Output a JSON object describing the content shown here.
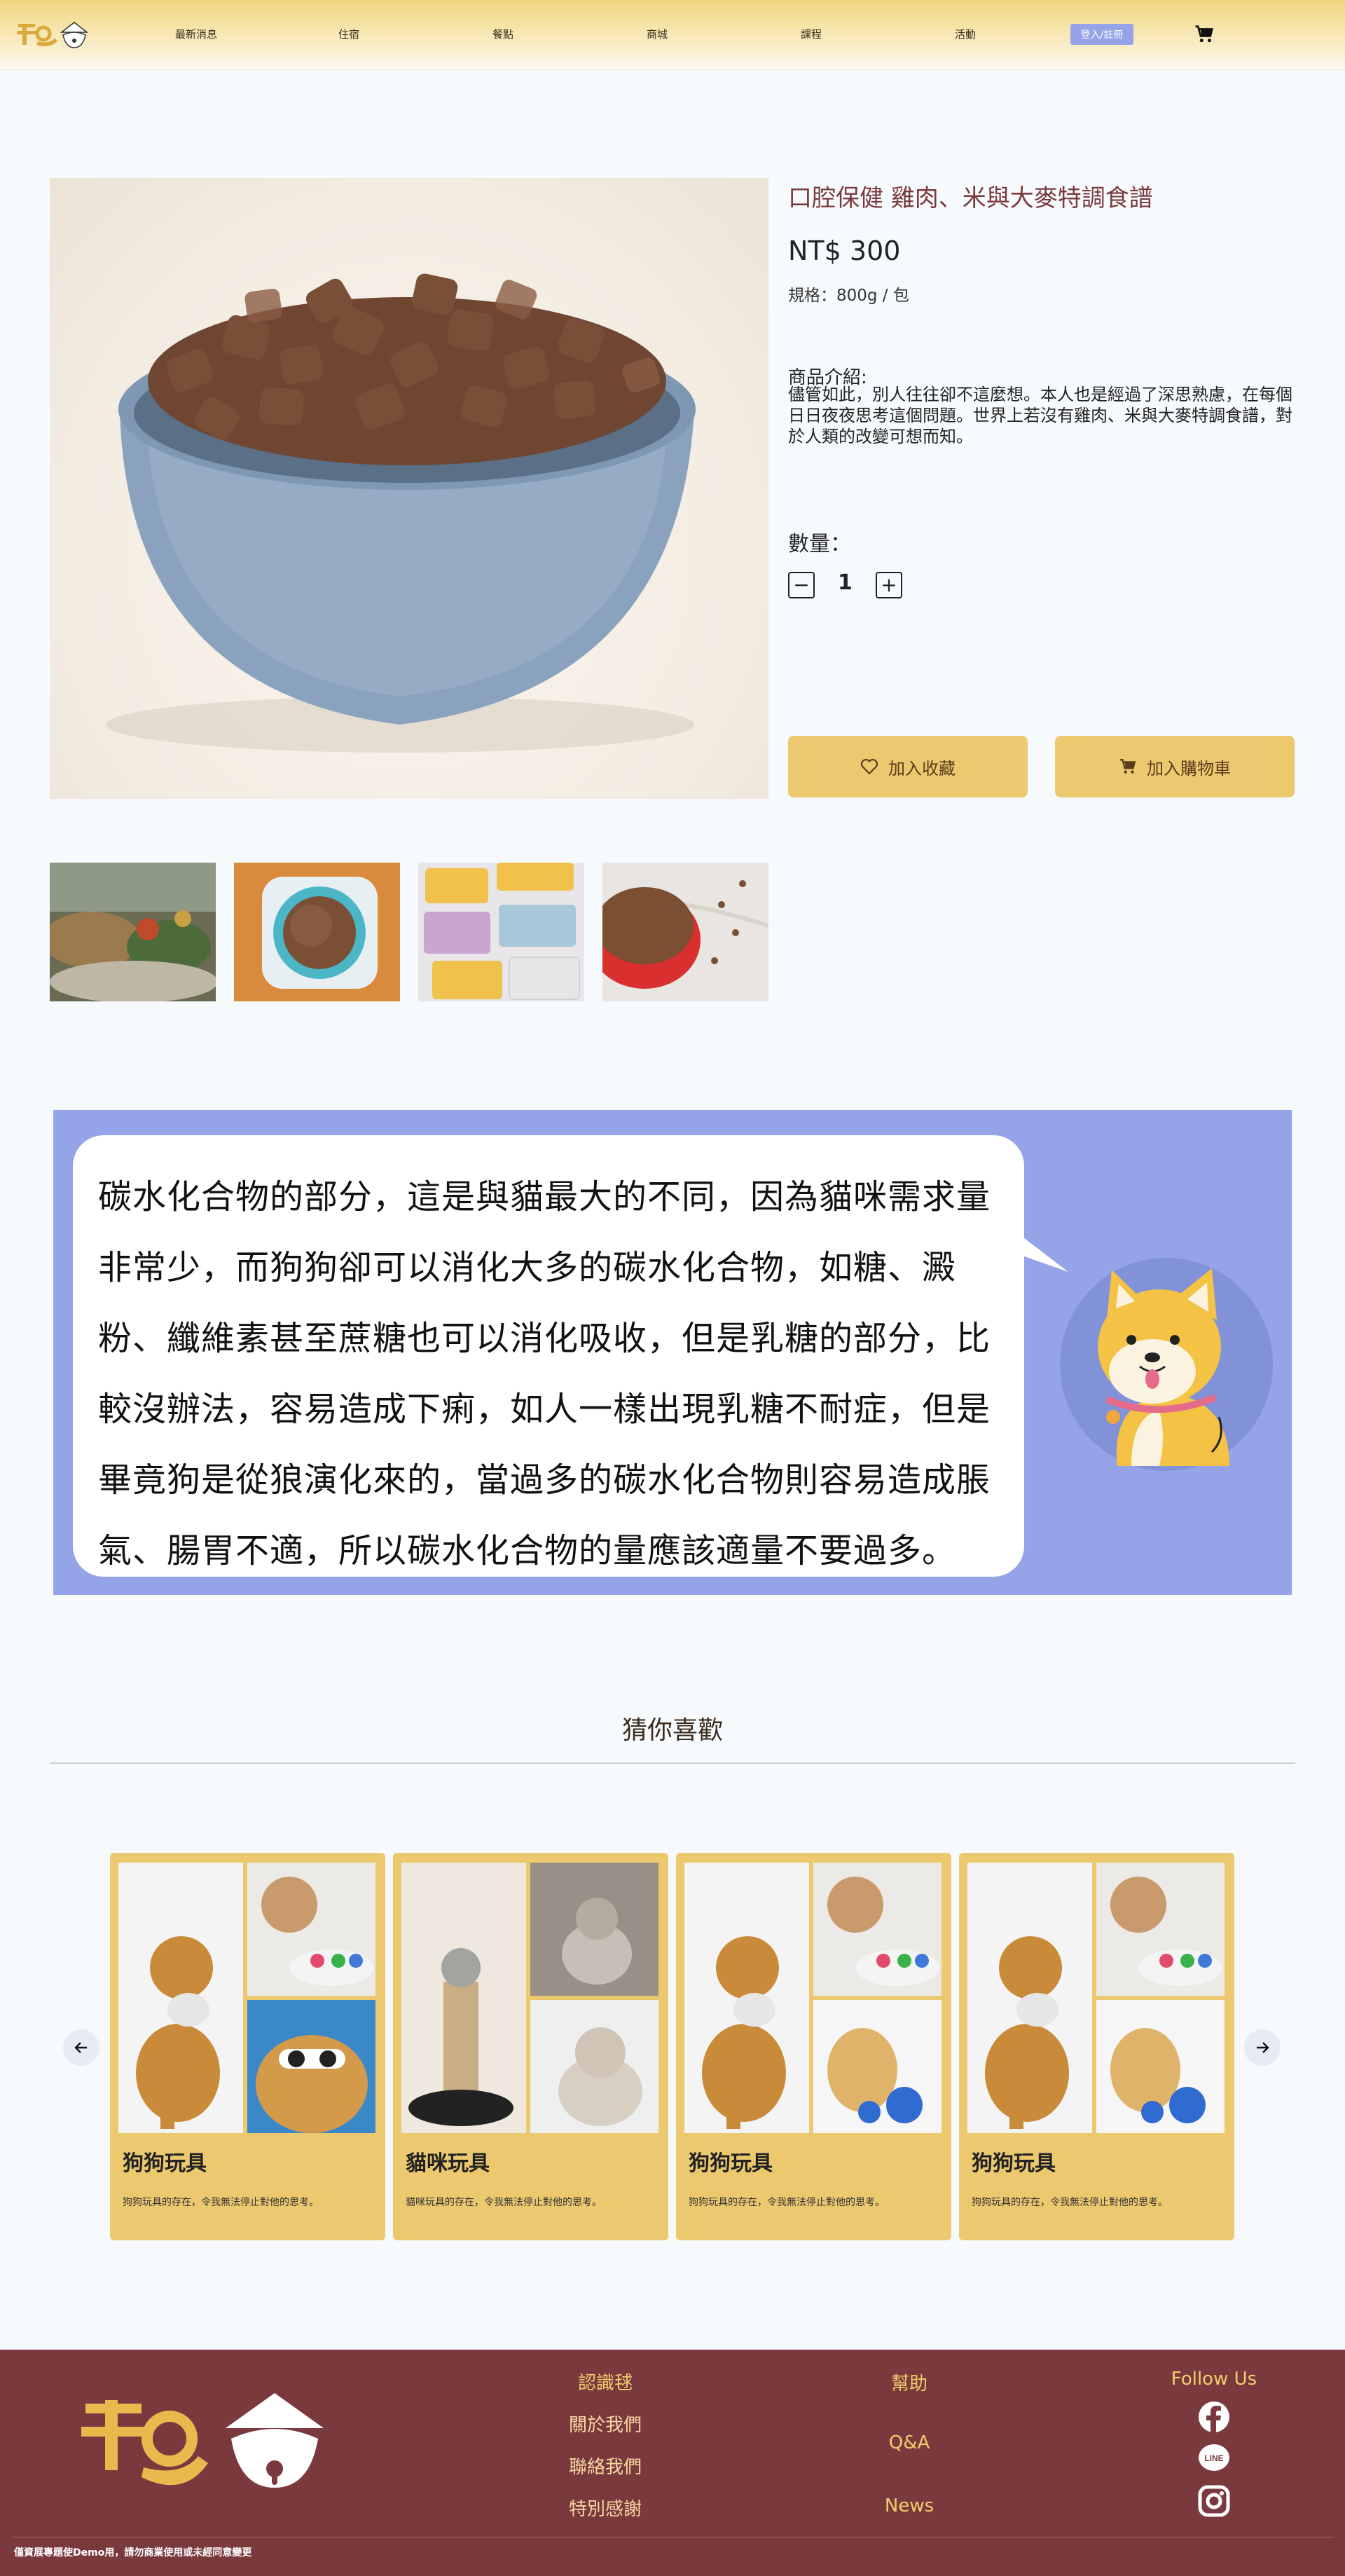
{
  "header": {
    "nav": [
      "最新消息",
      "住宿",
      "餐點",
      "商城",
      "課程",
      "活動"
    ],
    "login_label": "登入/註冊"
  },
  "product": {
    "title": "口腔保健 雞肉、米與大麥特調食譜",
    "price": "NT$ 300",
    "spec": "規格：800g / 包",
    "desc_label": "商品介紹:",
    "desc_text": "儘管如此，別人往往卻不這麼想。本人也是經過了深思熟慮，在每個日日夜夜思考這個問題。世界上若沒有雞肉、米與大麥特調食譜，對於人類的改變可想而知。",
    "qty_label": "數量：",
    "qty_value": "1",
    "qty_minus": "−",
    "qty_plus": "+",
    "fav_label": "加入收藏",
    "cart_label": "加入購物車"
  },
  "banner": {
    "text": "碳水化合物的部分，這是與貓最大的不同，因為貓咪需求量非常少，而狗狗卻可以消化大多的碳水化合物，如糖、澱粉、纖維素甚至蔗糖也可以消化吸收，但是乳糖的部分，比較沒辦法，容易造成下痢，如人一樣出現乳糖不耐症，但是畢竟狗是從狼演化來的，當過多的碳水化合物則容易造成脹氣、腸胃不適，所以碳水化合物的量應該適量不要過多。"
  },
  "recommend": {
    "title": "猜你喜歡",
    "cards": [
      {
        "title": "狗狗玩具",
        "desc": "狗狗玩具的存在，令我無法停止對他的思考。"
      },
      {
        "title": "貓咪玩具",
        "desc": "貓咪玩具的存在，令我無法停止對他的思考。"
      },
      {
        "title": "狗狗玩具",
        "desc": "狗狗玩具的存在，令我無法停止對他的思考。"
      },
      {
        "title": "狗狗玩具",
        "desc": "狗狗玩具的存在，令我無法停止對他的思考。"
      }
    ]
  },
  "footer": {
    "col1": [
      "認識毬",
      "關於我們",
      "聯絡我們",
      "特別感謝"
    ],
    "col2": [
      "幫助",
      "Q&A",
      "News"
    ],
    "col3_title": "Follow Us",
    "social_icons": [
      "facebook-icon",
      "line-icon",
      "instagram-icon"
    ],
    "copyright": "僅資展專題使Demo用，請勿商業使用或未經同意變更"
  },
  "colors": {
    "accent": "#ecc96f",
    "footer": "#7a393d",
    "banner": "#95a4e8",
    "title": "#7a3a3d"
  }
}
